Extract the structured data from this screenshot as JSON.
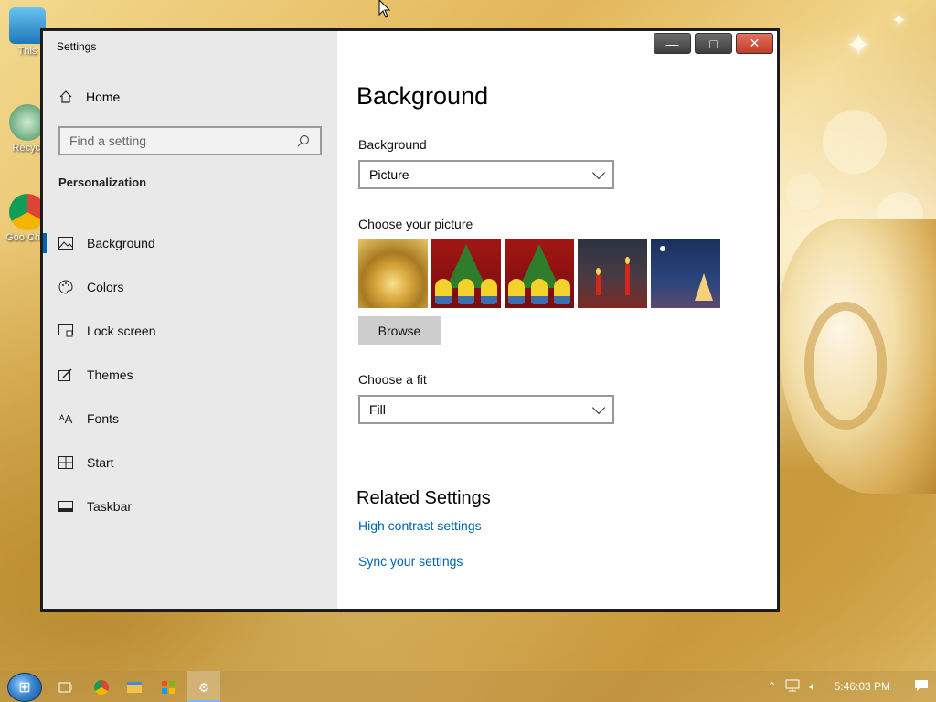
{
  "desktop": {
    "icons": [
      {
        "label": "This"
      },
      {
        "label": "Recycl"
      },
      {
        "label": "Goo Chro"
      }
    ]
  },
  "window": {
    "title": "Settings",
    "minimize_glyph": "—",
    "maximize_glyph": "□",
    "close_glyph": "✕"
  },
  "sidebar": {
    "home_label": "Home",
    "search_placeholder": "Find a setting",
    "section_title": "Personalization",
    "items": [
      {
        "label": "Background",
        "icon": "picture-icon",
        "active": true
      },
      {
        "label": "Colors",
        "icon": "palette-icon",
        "active": false
      },
      {
        "label": "Lock screen",
        "icon": "monitor-lock-icon",
        "active": false
      },
      {
        "label": "Themes",
        "icon": "brush-icon",
        "active": false
      },
      {
        "label": "Fonts",
        "icon": "font-icon",
        "active": false
      },
      {
        "label": "Start",
        "icon": "start-grid-icon",
        "active": false
      },
      {
        "label": "Taskbar",
        "icon": "taskbar-icon",
        "active": false
      }
    ]
  },
  "main": {
    "title": "Background",
    "background_label": "Background",
    "background_value": "Picture",
    "choose_picture_label": "Choose your picture",
    "browse_label": "Browse",
    "fit_label": "Choose a fit",
    "fit_value": "Fill",
    "related_title": "Related Settings",
    "links": [
      "High contrast settings",
      "Sync your settings"
    ]
  },
  "taskbar": {
    "clock": "5:46:03 PM"
  },
  "colors": {
    "accent": "#0063b1",
    "sidebar_bg": "#e9e9e9",
    "close_button": "#c33b25"
  }
}
